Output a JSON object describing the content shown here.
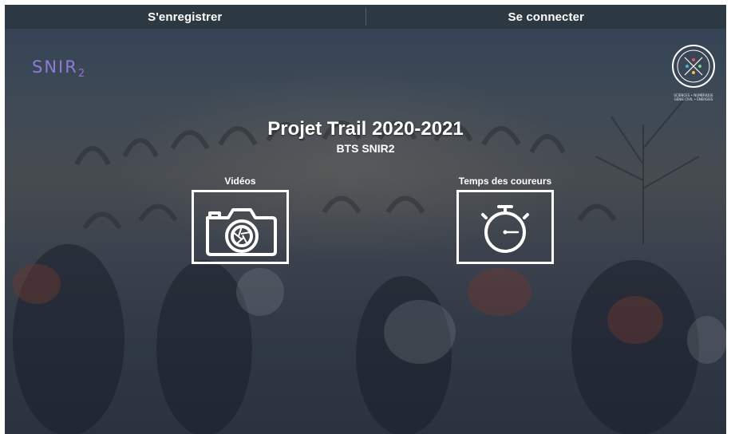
{
  "nav": {
    "register_label": "S'enregistrer",
    "login_label": "Se connecter"
  },
  "logos": {
    "snir_text": "SNIR",
    "snir_sub": "2",
    "lycee_caption_1": "SCIENCES • NUMÉRIQUE",
    "lycee_caption_2": "GÉNIE CIVIL • ÉNERGIES"
  },
  "hero": {
    "title": "Projet Trail 2020-2021",
    "subtitle": "BTS SNIR2"
  },
  "tiles": {
    "videos_label": "Vidéos",
    "times_label": "Temps des coureurs"
  },
  "icons": {
    "videos": "camera-icon",
    "times": "stopwatch-icon"
  },
  "colors": {
    "topbar": "#2d3942",
    "accent_logo": "#8c7bd8",
    "tile_border": "#ffffff"
  }
}
